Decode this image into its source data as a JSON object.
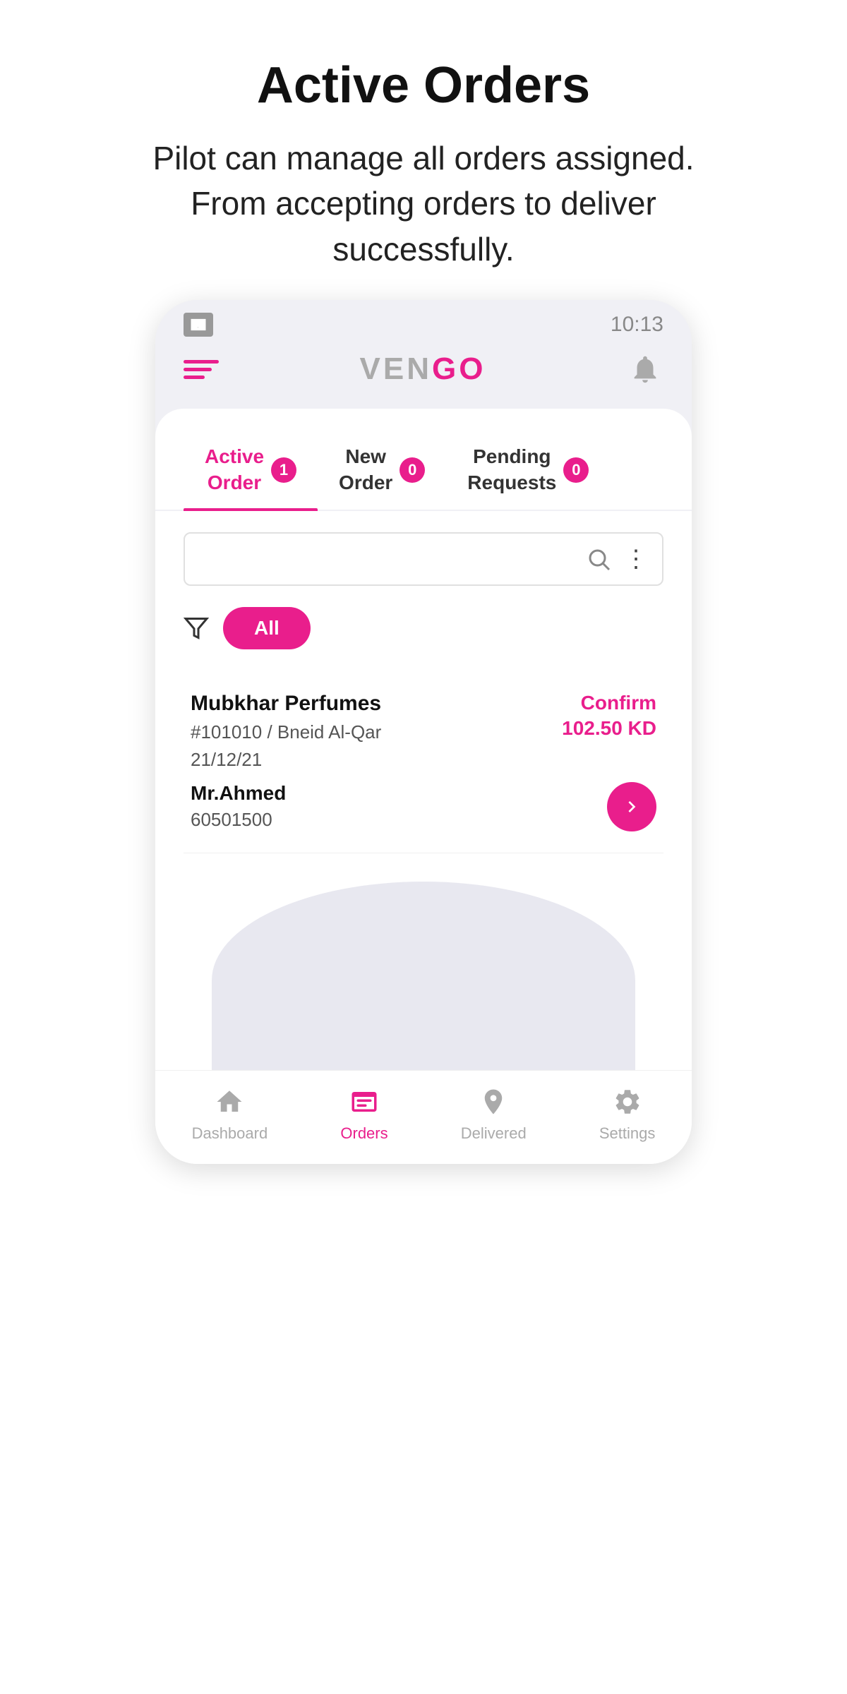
{
  "promo": {
    "title": "Active Orders",
    "description": "Pilot can manage all orders assigned. From accepting orders to deliver successfully."
  },
  "status_bar": {
    "time": "10:13"
  },
  "header": {
    "logo": "VENGO",
    "logo_prefix": "VEN",
    "logo_suffix": "GO"
  },
  "tabs": [
    {
      "id": "active-order",
      "label_line1": "Active",
      "label_line2": "Order",
      "badge": "1",
      "active": true
    },
    {
      "id": "new-order",
      "label_line1": "New",
      "label_line2": "Order",
      "badge": "0",
      "active": false
    },
    {
      "id": "pending-requests",
      "label_line1": "Pending",
      "label_line2": "Requests",
      "badge": "0",
      "active": false
    }
  ],
  "search": {
    "placeholder": ""
  },
  "filter": {
    "label": "All"
  },
  "order": {
    "shop_name": "Mubkhar Perfumes",
    "order_id": "#101010 / Bneid Al-Qar",
    "date": "21/12/21",
    "status_label": "Confirm",
    "amount": "102.50 KD",
    "customer_name": "Mr.Ahmed",
    "customer_phone": "60501500"
  },
  "bottom_nav": [
    {
      "id": "dashboard",
      "label": "Dashboard",
      "active": false
    },
    {
      "id": "orders",
      "label": "Orders",
      "active": true
    },
    {
      "id": "delivered",
      "label": "Delivered",
      "active": false
    },
    {
      "id": "settings",
      "label": "Settings",
      "active": false
    }
  ]
}
